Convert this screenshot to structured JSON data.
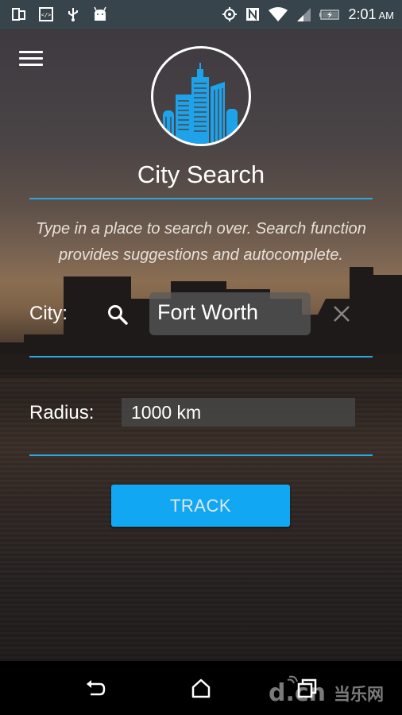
{
  "status_bar": {
    "left_icons": [
      "screen-mirror-icon",
      "developer-code-icon",
      "usb-icon",
      "android-icon"
    ],
    "right_icons": [
      "gps-icon",
      "nfc-icon",
      "wifi-icon",
      "cell-signal-icon",
      "battery-charging-icon"
    ],
    "time": "2:01",
    "ampm": "AM"
  },
  "header": {
    "menu_icon": "hamburger-menu-icon",
    "logo_icon": "city-buildings-icon",
    "title": "City Search",
    "description": "Type in a place to search over. Search function provides suggestions and autocomplete."
  },
  "form": {
    "city_label": "City:",
    "city_value": "Fort Worth",
    "search_icon": "search-icon",
    "clear_icon": "close-icon",
    "radius_label": "Radius:",
    "radius_value": "1000 km",
    "submit_label": "TRACK"
  },
  "colors": {
    "accent": "#12a7f2",
    "divider": "#29a8e6",
    "status_bar": "#37444b"
  },
  "nav_bar": {
    "buttons": [
      "back-icon",
      "home-icon",
      "recents-icon"
    ],
    "watermark": "d.cn 当乐网"
  }
}
